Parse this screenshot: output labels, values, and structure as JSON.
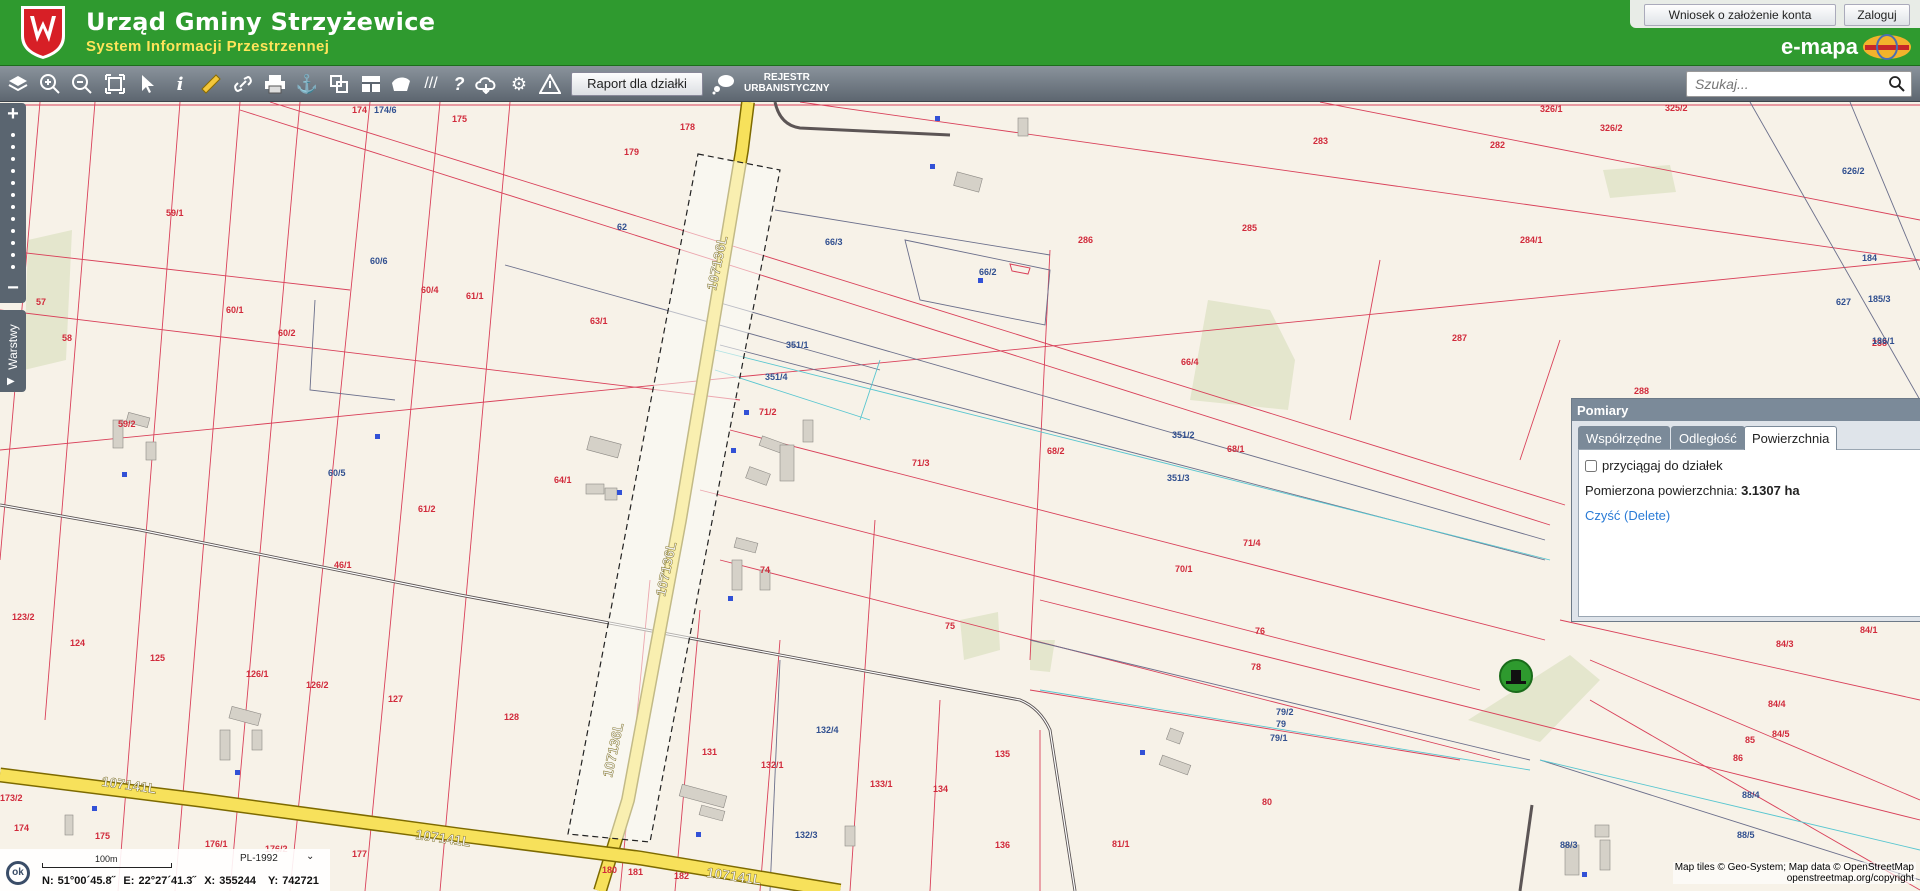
{
  "header": {
    "title": "Urząd Gminy Strzyżewice",
    "subtitle": "System Informacji Przestrzennej",
    "brand": "e-mapa",
    "green": "#2f9a2f"
  },
  "topbar": {
    "apply_label": "Wniosek o założenie konta",
    "login_label": "Zaloguj"
  },
  "toolbar": {
    "raport_label": "Raport dla działki",
    "rejestr_line1": "REJESTR",
    "rejestr_line2": "URBANISTYCZNY",
    "tools": [
      "layers-icon",
      "zoom-in-icon",
      "zoom-out-icon",
      "zoom-extent-icon",
      "pointer-icon",
      "info-icon",
      "measure-ruler-icon",
      "link-icon",
      "print-icon",
      "anchor-icon",
      "compare-icon",
      "layout-icon",
      "draw-icon",
      "hatch-icon",
      "help-icon",
      "cloud-download-icon",
      "settings-icon",
      "warning-icon"
    ]
  },
  "search": {
    "placeholder": "Szukaj..."
  },
  "sidebar": {
    "layers_label": "Warstwy"
  },
  "panel": {
    "title": "Pomiary",
    "tabs": [
      "Współrzędne",
      "Odległość",
      "Powierzchnia"
    ],
    "active_tab": "Powierzchnia",
    "snap_label": "przyciągaj do działek",
    "snap_checked": false,
    "area_label": "Pomierzona powierzchnia:",
    "area_value": "3.1307 ha",
    "clear_label": "Czyść (Delete)"
  },
  "status": {
    "ok_label": "ok",
    "scale_label": "100m",
    "crs": "PL-1992",
    "lat": "N: 51°00´45.8˝",
    "lon": "E: 22°27´41.3˝",
    "x": "X: 355244",
    "y": "Y: 742721"
  },
  "attribution": {
    "line1": "Map tiles © Geo-System; Map data © OpenStreetMap",
    "line2": "openstreetmap.org/copyright"
  },
  "roads": [
    "107136L",
    "107136L",
    "107141L",
    "107141L",
    "107136L",
    "107141L"
  ],
  "parcels_red": [
    "174",
    "175",
    "178",
    "179",
    "59/1",
    "57",
    "58",
    "60/1",
    "60/2",
    "60/4",
    "61/1",
    "63/1",
    "59/2",
    "64/1",
    "61/2",
    "46/1",
    "123/2",
    "124",
    "125",
    "126/1",
    "126/2",
    "127",
    "128",
    "173/2",
    "174",
    "175",
    "176/1",
    "176/2",
    "177",
    "180",
    "181",
    "182",
    "71/2",
    "74",
    "71/3",
    "68/2",
    "68/1",
    "75",
    "76",
    "78",
    "70/1",
    "71/4",
    "131",
    "132/1",
    "133/1",
    "134",
    "135",
    "136",
    "81/1",
    "80",
    "286",
    "285",
    "284/1",
    "283",
    "282",
    "287",
    "288",
    "66/4",
    "326/1",
    "326/2",
    "325/2",
    "238",
    "84/1",
    "84/3",
    "84/4",
    "84/5",
    "85",
    "86"
  ],
  "parcels_blue": [
    "174/6",
    "62",
    "60/6",
    "60/5",
    "66/3",
    "66/2",
    "351/1",
    "351/4",
    "351/2",
    "351/3",
    "132/4",
    "132/3",
    "79/2",
    "79",
    "79/1",
    "88/4",
    "88/5",
    "88/3",
    "626/2",
    "184",
    "185/3",
    "186/1",
    "627"
  ]
}
